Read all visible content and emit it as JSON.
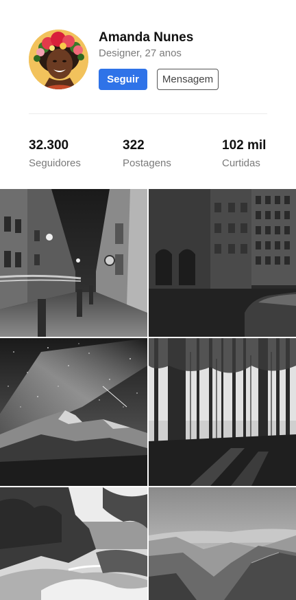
{
  "profile": {
    "name": "Amanda Nunes",
    "subtitle": "Designer, 27 anos",
    "follow_label": "Seguir",
    "message_label": "Mensagem",
    "accent_color": "#2f73e8"
  },
  "stats": [
    {
      "value": "32.300",
      "label": "Seguidores"
    },
    {
      "value": "322",
      "label": "Postagens"
    },
    {
      "value": "102 mil",
      "label": "Curtidas"
    }
  ]
}
